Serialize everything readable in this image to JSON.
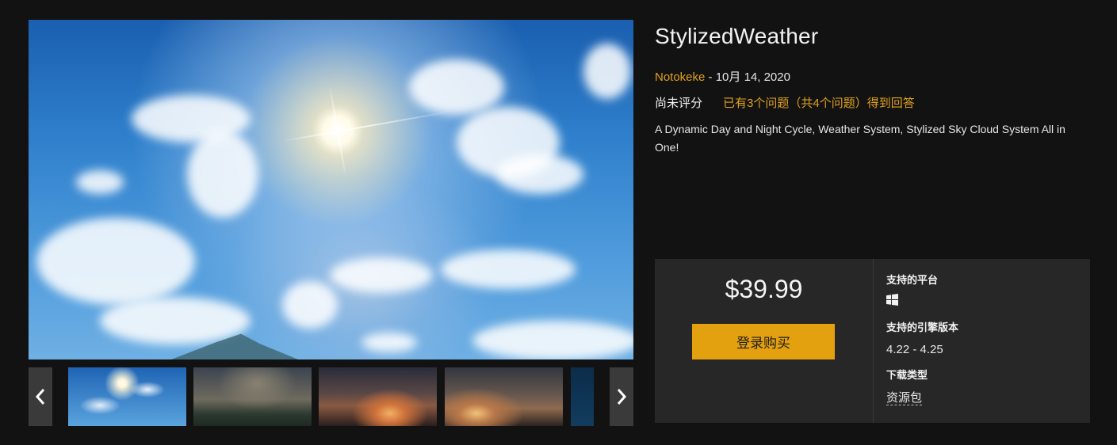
{
  "product": {
    "title": "StylizedWeather",
    "seller": "Notokeke",
    "separator": " - ",
    "date": "10月 14, 2020",
    "rating": "尚未评分",
    "qa_summary": "已有3个问题（共4个问题）得到回答",
    "description": "A Dynamic Day and Night Cycle, Weather System, Stylized Sky Cloud System All in One!"
  },
  "gallery": {
    "thumbnails": [
      {
        "name": "thumb-sunny-sky",
        "active": true
      },
      {
        "name": "thumb-cloudy-landscape",
        "active": false
      },
      {
        "name": "thumb-sunset-clouds",
        "active": false
      },
      {
        "name": "thumb-dusk-sky",
        "active": false
      },
      {
        "name": "thumb-night-partial",
        "active": false
      }
    ]
  },
  "purchase": {
    "price": "$39.99",
    "buy_label": "登录购买",
    "platforms_label": "支持的平台",
    "platform_icon": "windows-icon",
    "engine_label": "支持的引擎版本",
    "engine_versions": "4.22 - 4.25",
    "download_label": "下载类型",
    "download_type": "资源包"
  },
  "colors": {
    "accent": "#e0a21c",
    "button": "#e3a00f",
    "background": "#121212",
    "panel": "#272727"
  }
}
